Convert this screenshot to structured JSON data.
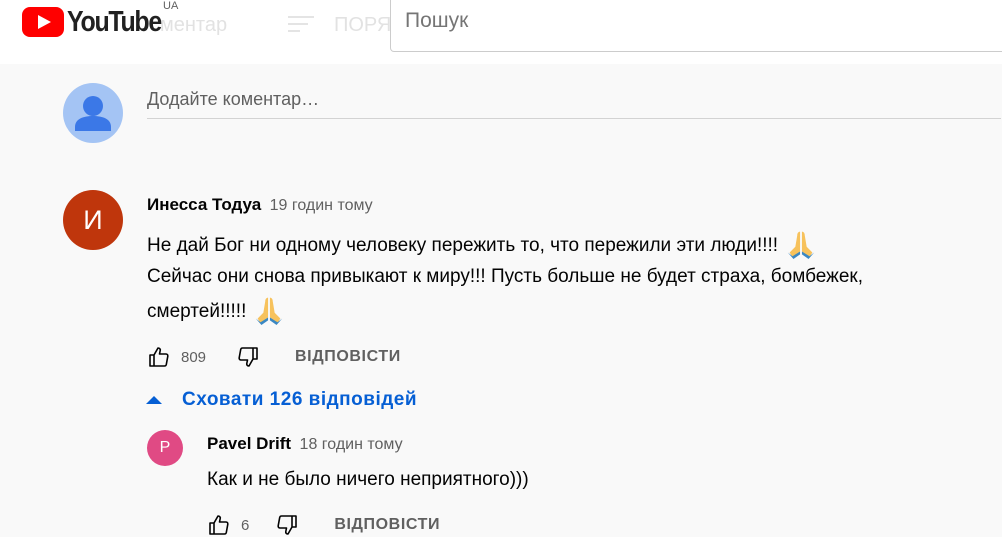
{
  "header": {
    "logo_text": "YouTube",
    "country_code": "UA",
    "ghost_comments_text": "ментар",
    "ghost_sort_text": "ПОРЯ",
    "search_placeholder": "Пошук",
    "brand_color": "#ff0000"
  },
  "add_comment": {
    "placeholder": "Додайте коментар…",
    "avatar_icon": "user-silhouette-icon"
  },
  "comment": {
    "avatar_letter": "И",
    "avatar_color": "#bf360c",
    "author": "Инесса Тодуа",
    "time": "19 годин тому",
    "line1": "Не дай Бог ни одному человеку пережить то, что пережили эти люди!!!!",
    "line2": "Сейчас они снова привыкают к миру!!! Пусть больше не будет страха, бомбежек,",
    "line3": "смертей!!!!!",
    "emoji_icon": "folded-hands-emoji",
    "likes": "809",
    "reply_label": "ВІДПОВІСТИ"
  },
  "replies_toggle": {
    "label": "Сховати 126 відповідей",
    "color": "#065fd4"
  },
  "reply": {
    "avatar_letter": "P",
    "avatar_color": "#e04a84",
    "author": "Pavel Drift",
    "time": "18 годин тому",
    "text": "Как и не было ничего неприятного)))",
    "likes": "6",
    "reply_label": "ВІДПОВІСТИ"
  }
}
